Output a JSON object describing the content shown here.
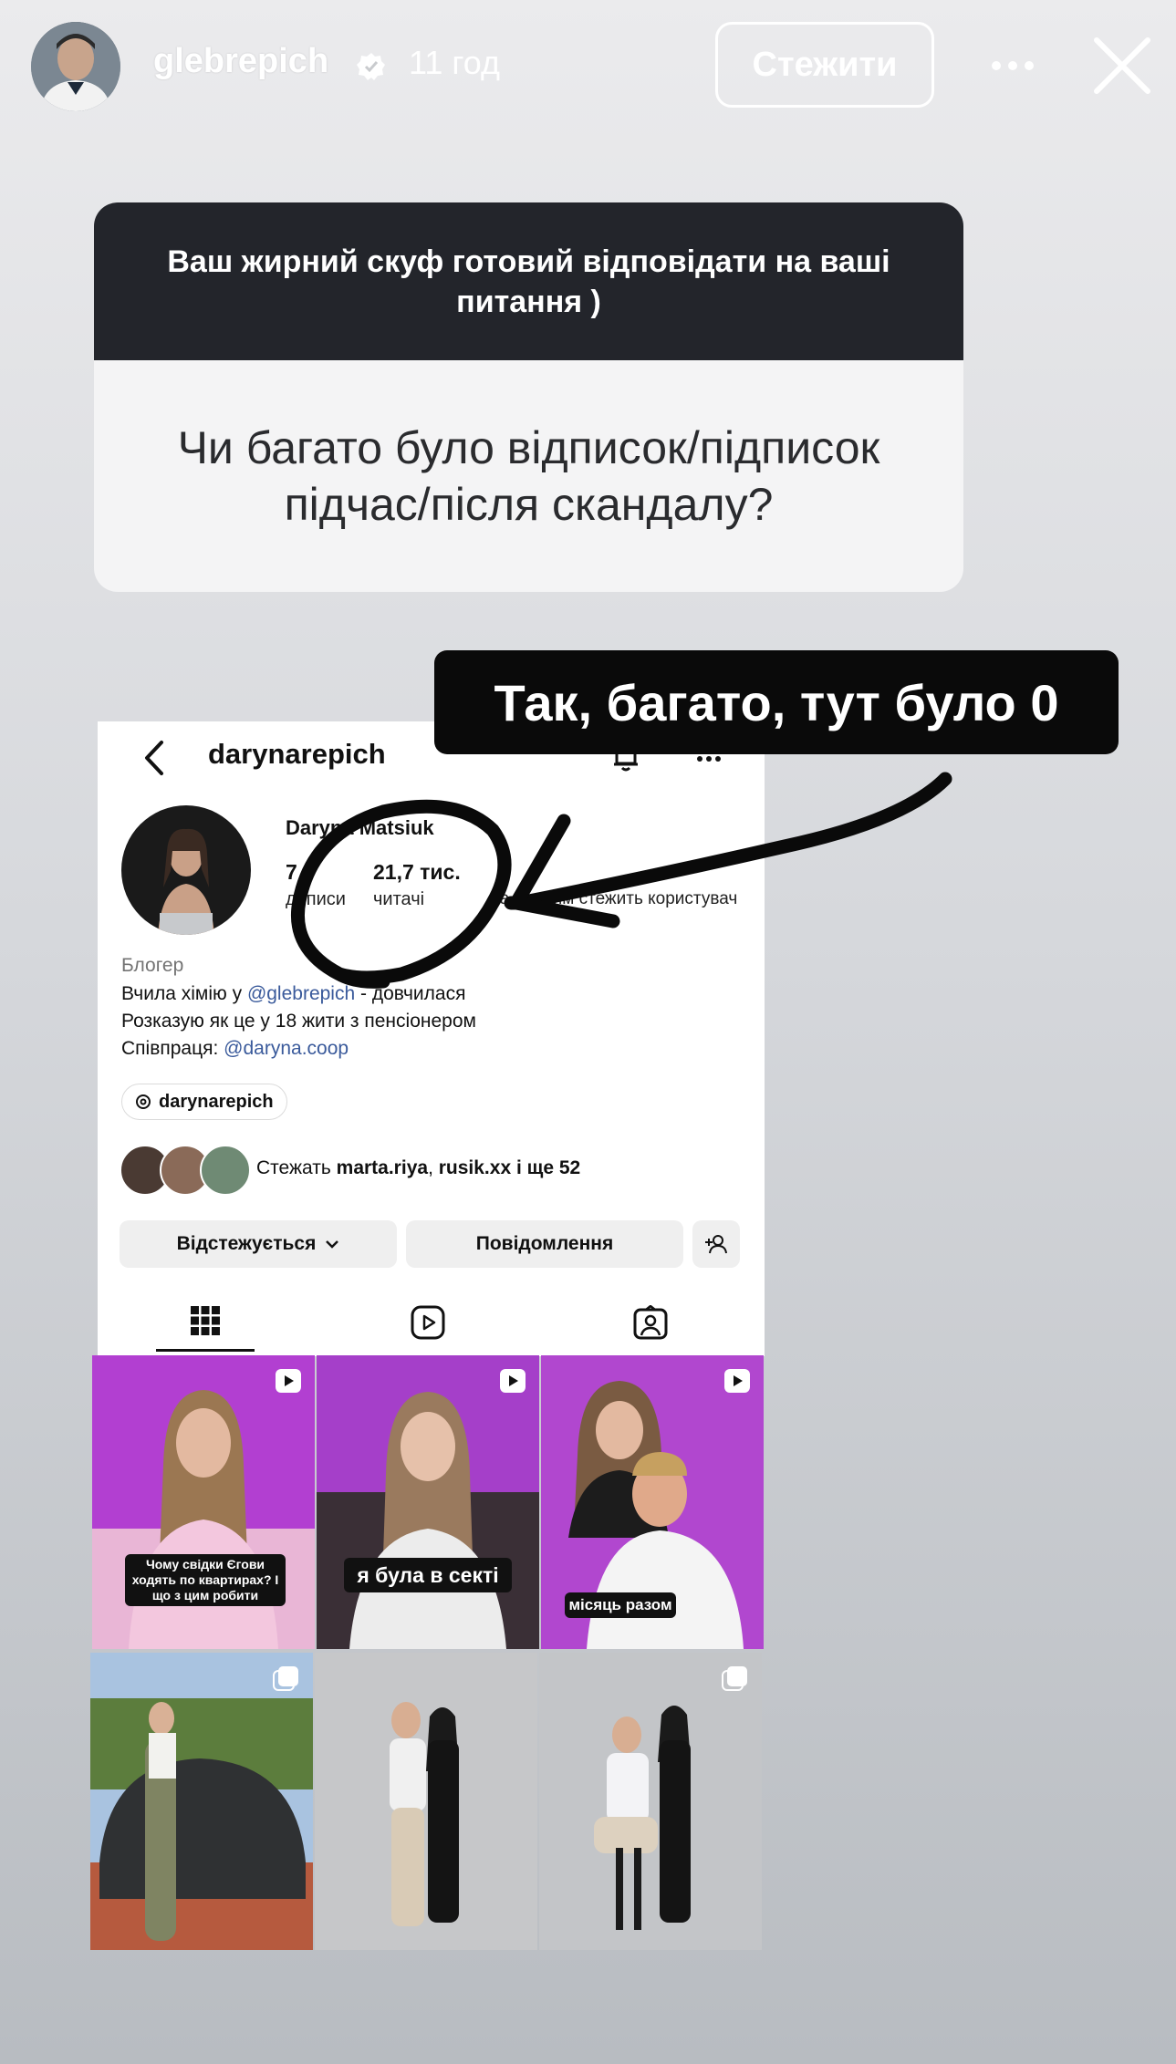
{
  "story_header": {
    "username": "glebrepich",
    "time": "11 год",
    "follow_label": "Стежити"
  },
  "question_card": {
    "title": "Ваш жирний скуф готовий відповідати на ваші питання )",
    "question": "Чи багато було відписок/підписок підчас/після скандалу?"
  },
  "answer_label": "Так, багато, тут було 0",
  "profile": {
    "username": "darynarepich",
    "name": "Daryna Matsiuk",
    "posts_value": "7",
    "posts_label": "дописи",
    "followers_value": "21,7 тис.",
    "followers_label": "читачі",
    "following_label": "за кожним стежить користувач",
    "category": "Блогер",
    "bio_line1_prefix": "Вчила хімію у ",
    "bio_line1_mention": "@glebrepich",
    "bio_line1_suffix": " - довчилася",
    "bio_line2": "Розказую як це у 18 жити з пенсіонером",
    "bio_line3_prefix": "Співпраця: ",
    "bio_line3_mention": "@daryna.coop",
    "threads_badge": "darynarepich",
    "followed_by_prefix": "Стежать ",
    "followed_by_names": "marta.riya",
    "followed_by_sep": ", ",
    "followed_by_names2": "rusik.xx",
    "followed_by_suffix": " і ще 52",
    "following_button": "Відстежується",
    "message_button": "Повідомлення"
  },
  "posts": [
    {
      "caption": "Чому свідки Єгови ходять по квартирах? І що з цим робити"
    },
    {
      "caption": "я була в секті"
    },
    {
      "caption": "місяць разом"
    },
    {
      "caption": ""
    },
    {
      "caption": ""
    },
    {
      "caption": ""
    }
  ],
  "colors": {
    "mention": "#3a5a9b",
    "question_header": "#23252b",
    "answer_bg": "#0a0a0a"
  }
}
